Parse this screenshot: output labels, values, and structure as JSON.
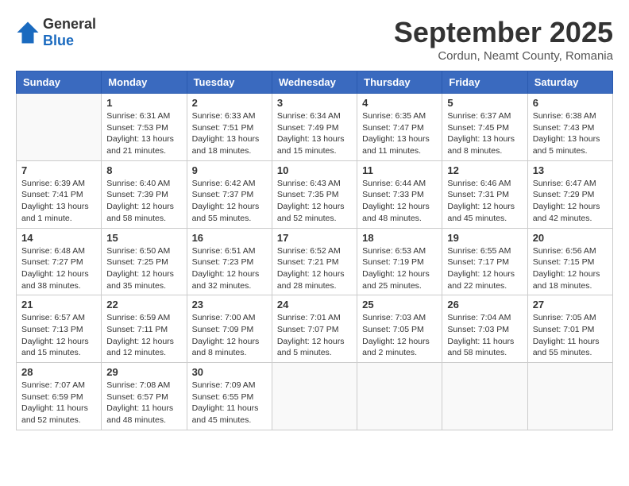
{
  "logo": {
    "general": "General",
    "blue": "Blue"
  },
  "title": "September 2025",
  "subtitle": "Cordun, Neamt County, Romania",
  "weekdays": [
    "Sunday",
    "Monday",
    "Tuesday",
    "Wednesday",
    "Thursday",
    "Friday",
    "Saturday"
  ],
  "weeks": [
    [
      {
        "day": "",
        "info": ""
      },
      {
        "day": "1",
        "info": "Sunrise: 6:31 AM\nSunset: 7:53 PM\nDaylight: 13 hours\nand 21 minutes."
      },
      {
        "day": "2",
        "info": "Sunrise: 6:33 AM\nSunset: 7:51 PM\nDaylight: 13 hours\nand 18 minutes."
      },
      {
        "day": "3",
        "info": "Sunrise: 6:34 AM\nSunset: 7:49 PM\nDaylight: 13 hours\nand 15 minutes."
      },
      {
        "day": "4",
        "info": "Sunrise: 6:35 AM\nSunset: 7:47 PM\nDaylight: 13 hours\nand 11 minutes."
      },
      {
        "day": "5",
        "info": "Sunrise: 6:37 AM\nSunset: 7:45 PM\nDaylight: 13 hours\nand 8 minutes."
      },
      {
        "day": "6",
        "info": "Sunrise: 6:38 AM\nSunset: 7:43 PM\nDaylight: 13 hours\nand 5 minutes."
      }
    ],
    [
      {
        "day": "7",
        "info": "Sunrise: 6:39 AM\nSunset: 7:41 PM\nDaylight: 13 hours\nand 1 minute."
      },
      {
        "day": "8",
        "info": "Sunrise: 6:40 AM\nSunset: 7:39 PM\nDaylight: 12 hours\nand 58 minutes."
      },
      {
        "day": "9",
        "info": "Sunrise: 6:42 AM\nSunset: 7:37 PM\nDaylight: 12 hours\nand 55 minutes."
      },
      {
        "day": "10",
        "info": "Sunrise: 6:43 AM\nSunset: 7:35 PM\nDaylight: 12 hours\nand 52 minutes."
      },
      {
        "day": "11",
        "info": "Sunrise: 6:44 AM\nSunset: 7:33 PM\nDaylight: 12 hours\nand 48 minutes."
      },
      {
        "day": "12",
        "info": "Sunrise: 6:46 AM\nSunset: 7:31 PM\nDaylight: 12 hours\nand 45 minutes."
      },
      {
        "day": "13",
        "info": "Sunrise: 6:47 AM\nSunset: 7:29 PM\nDaylight: 12 hours\nand 42 minutes."
      }
    ],
    [
      {
        "day": "14",
        "info": "Sunrise: 6:48 AM\nSunset: 7:27 PM\nDaylight: 12 hours\nand 38 minutes."
      },
      {
        "day": "15",
        "info": "Sunrise: 6:50 AM\nSunset: 7:25 PM\nDaylight: 12 hours\nand 35 minutes."
      },
      {
        "day": "16",
        "info": "Sunrise: 6:51 AM\nSunset: 7:23 PM\nDaylight: 12 hours\nand 32 minutes."
      },
      {
        "day": "17",
        "info": "Sunrise: 6:52 AM\nSunset: 7:21 PM\nDaylight: 12 hours\nand 28 minutes."
      },
      {
        "day": "18",
        "info": "Sunrise: 6:53 AM\nSunset: 7:19 PM\nDaylight: 12 hours\nand 25 minutes."
      },
      {
        "day": "19",
        "info": "Sunrise: 6:55 AM\nSunset: 7:17 PM\nDaylight: 12 hours\nand 22 minutes."
      },
      {
        "day": "20",
        "info": "Sunrise: 6:56 AM\nSunset: 7:15 PM\nDaylight: 12 hours\nand 18 minutes."
      }
    ],
    [
      {
        "day": "21",
        "info": "Sunrise: 6:57 AM\nSunset: 7:13 PM\nDaylight: 12 hours\nand 15 minutes."
      },
      {
        "day": "22",
        "info": "Sunrise: 6:59 AM\nSunset: 7:11 PM\nDaylight: 12 hours\nand 12 minutes."
      },
      {
        "day": "23",
        "info": "Sunrise: 7:00 AM\nSunset: 7:09 PM\nDaylight: 12 hours\nand 8 minutes."
      },
      {
        "day": "24",
        "info": "Sunrise: 7:01 AM\nSunset: 7:07 PM\nDaylight: 12 hours\nand 5 minutes."
      },
      {
        "day": "25",
        "info": "Sunrise: 7:03 AM\nSunset: 7:05 PM\nDaylight: 12 hours\nand 2 minutes."
      },
      {
        "day": "26",
        "info": "Sunrise: 7:04 AM\nSunset: 7:03 PM\nDaylight: 11 hours\nand 58 minutes."
      },
      {
        "day": "27",
        "info": "Sunrise: 7:05 AM\nSunset: 7:01 PM\nDaylight: 11 hours\nand 55 minutes."
      }
    ],
    [
      {
        "day": "28",
        "info": "Sunrise: 7:07 AM\nSunset: 6:59 PM\nDaylight: 11 hours\nand 52 minutes."
      },
      {
        "day": "29",
        "info": "Sunrise: 7:08 AM\nSunset: 6:57 PM\nDaylight: 11 hours\nand 48 minutes."
      },
      {
        "day": "30",
        "info": "Sunrise: 7:09 AM\nSunset: 6:55 PM\nDaylight: 11 hours\nand 45 minutes."
      },
      {
        "day": "",
        "info": ""
      },
      {
        "day": "",
        "info": ""
      },
      {
        "day": "",
        "info": ""
      },
      {
        "day": "",
        "info": ""
      }
    ]
  ]
}
